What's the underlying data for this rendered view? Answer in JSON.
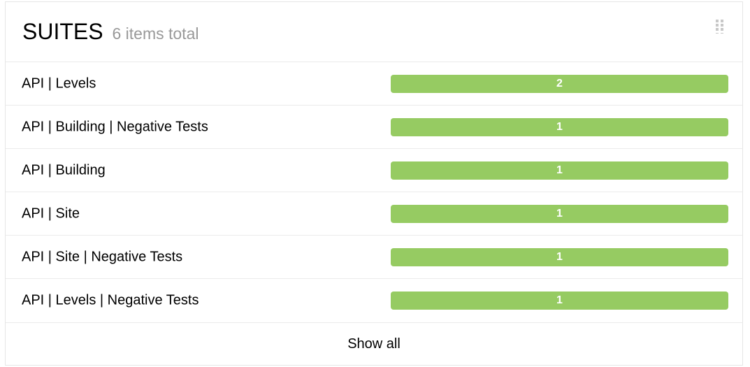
{
  "widget": {
    "title": "SUITES",
    "subtitle": "6 items total",
    "drag_handle_icon": "grip-dots-icon",
    "bar_color": "#96cb62",
    "footer_label": "Show all"
  },
  "suites": [
    {
      "name": "API | Levels",
      "count": "2"
    },
    {
      "name": "API | Building | Negative Tests",
      "count": "1"
    },
    {
      "name": "API | Building",
      "count": "1"
    },
    {
      "name": "API | Site",
      "count": "1"
    },
    {
      "name": "API | Site | Negative Tests",
      "count": "1"
    },
    {
      "name": "API | Levels | Negative Tests",
      "count": "1"
    }
  ]
}
